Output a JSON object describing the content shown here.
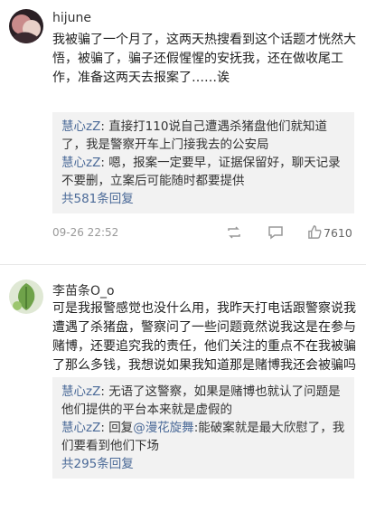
{
  "comments": [
    {
      "user": "hijune",
      "text": "我被骗了一个月了，这两天热搜看到这个话题才恍然大悟，被骗了，骗子还假惺惺的安抚我，还在做收尾工作，准备这两天去报案了……诶",
      "replies": [
        {
          "user": "慧心zZ",
          "sep": ": ",
          "text": "直接打110说自己遭遇杀猪盘他们就知道了，我是警察开车上门接我去的公安局"
        },
        {
          "user": "慧心zZ",
          "sep": ": ",
          "text": "嗯，报案一定要早，证据保留好，聊天记录不要删，立案后可能随时都要提供"
        }
      ],
      "more": "共581条回复",
      "time": "09-26 22:52",
      "likes": "7610"
    },
    {
      "user": "李苗条O_o",
      "text": "可是我报警感觉也没什么用，我昨天打电话跟警察说我遭遇了杀猪盘，警察问了一些问题竟然说我这是在参与赌博，还要追究我的责任，他们关注的重点不在我被骗了那么多钱，我想说如果我知道那是赌博我还会被骗吗",
      "replies": [
        {
          "user": "慧心zZ",
          "sep": ": ",
          "text": "无语了这警察，如果是赌博也就认了问题是他们提供的平台本来就是虚假的"
        },
        {
          "user": "慧心zZ",
          "sep": ": ",
          "prefix": "回复",
          "mention": "@漫花旋舞",
          "text": ":能破案就是最大欣慰了，我们要看到他们下场"
        }
      ],
      "more": "共295条回复"
    }
  ],
  "icons": {
    "share": "share-icon",
    "comment": "comment-icon",
    "like": "thumbs-up-icon"
  },
  "colors": {
    "link": "#4b6a98",
    "reply_bg": "#f2f2f2",
    "meta": "#999999"
  }
}
